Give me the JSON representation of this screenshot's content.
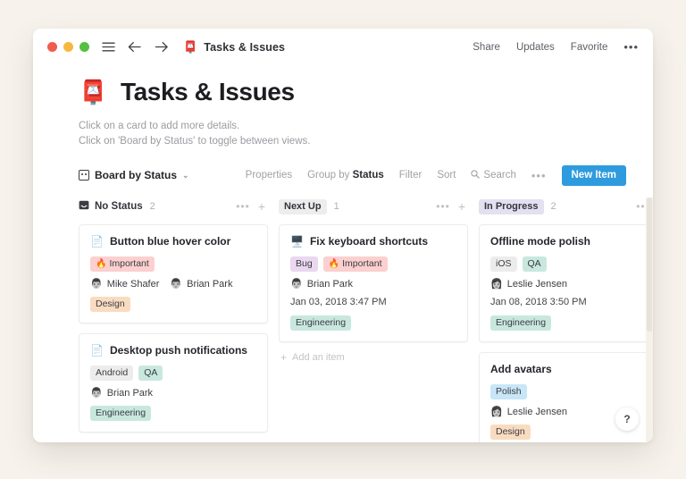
{
  "window": {
    "titlebar": {
      "doc_emoji": "📮",
      "doc_title": "Tasks & Issues",
      "actions": [
        "Share",
        "Updates",
        "Favorite"
      ],
      "more_label": "•••"
    }
  },
  "page": {
    "emoji": "📮",
    "title": "Tasks & Issues",
    "subtitle_line1": "Click on a card to add more details.",
    "subtitle_line2": "Click on 'Board by Status' to toggle between views."
  },
  "viewbar": {
    "view_name": "Board by Status",
    "caret": "⌄",
    "properties": "Properties",
    "group_by_prefix": "Group by ",
    "group_by_value": "Status",
    "filter": "Filter",
    "sort": "Sort",
    "search": "Search",
    "more": "•••",
    "new_item": "New Item"
  },
  "board": {
    "add_item_label": "Add an item",
    "col_more": "•••",
    "col_plus": "+",
    "columns": [
      {
        "name": "No Status",
        "chip_bg": "transparent",
        "has_icon": true,
        "count": "2",
        "show_add": true,
        "cards": [
          {
            "emoji": "📄",
            "title": "Button blue hover color",
            "tags": [
              {
                "label": "Important",
                "emoji": "🔥",
                "bg": "#fbd0cf",
                "color": "#3a3c41"
              }
            ],
            "people": [
              {
                "avatar": "👨",
                "name": "Mike Shafer"
              },
              {
                "avatar": "👨",
                "name": "Brian Park"
              }
            ],
            "date": "",
            "footer_tags": [
              {
                "label": "Design",
                "bg": "#f9dcc0",
                "color": "#3a3c41"
              }
            ]
          },
          {
            "emoji": "📄",
            "title": "Desktop push notifications",
            "tags": [
              {
                "label": "Android",
                "emoji": "",
                "bg": "#ececec",
                "color": "#3a3c41"
              },
              {
                "label": "QA",
                "emoji": "",
                "bg": "#c8e8de",
                "color": "#3a3c41"
              }
            ],
            "people": [
              {
                "avatar": "👨",
                "name": "Brian Park"
              }
            ],
            "date": "",
            "footer_tags": [
              {
                "label": "Engineering",
                "bg": "#c8e8de",
                "color": "#3a3c41"
              }
            ]
          }
        ]
      },
      {
        "name": "Next Up",
        "chip_bg": "#ededed",
        "has_icon": false,
        "count": "1",
        "show_add": true,
        "cards": [
          {
            "emoji": "🖥️",
            "title": "Fix keyboard shortcuts",
            "tags": [
              {
                "label": "Bug",
                "emoji": "",
                "bg": "#ead7f0",
                "color": "#3a3c41"
              },
              {
                "label": "Important",
                "emoji": "🔥",
                "bg": "#fbd0cf",
                "color": "#3a3c41"
              }
            ],
            "people": [
              {
                "avatar": "👨",
                "name": "Brian Park"
              }
            ],
            "date": "Jan 03, 2018 3:47 PM",
            "footer_tags": [
              {
                "label": "Engineering",
                "bg": "#c8e8de",
                "color": "#3a3c41"
              }
            ]
          }
        ]
      },
      {
        "name": "In Progress",
        "chip_bg": "#e3e0f2",
        "has_icon": false,
        "count": "2",
        "show_add": true,
        "cards": [
          {
            "emoji": "",
            "title": "Offline mode polish",
            "tags": [
              {
                "label": "iOS",
                "emoji": "",
                "bg": "#ececec",
                "color": "#3a3c41"
              },
              {
                "label": "QA",
                "emoji": "",
                "bg": "#c8e8de",
                "color": "#3a3c41"
              }
            ],
            "people": [
              {
                "avatar": "👩",
                "name": "Leslie Jensen"
              }
            ],
            "date": "Jan 08, 2018 3:50 PM",
            "footer_tags": [
              {
                "label": "Engineering",
                "bg": "#c8e8de",
                "color": "#3a3c41"
              }
            ]
          },
          {
            "emoji": "",
            "title": "Add avatars",
            "tags": [
              {
                "label": "Polish",
                "emoji": "",
                "bg": "#c8e6f7",
                "color": "#3a3c41"
              }
            ],
            "people": [
              {
                "avatar": "👩",
                "name": "Leslie Jensen"
              }
            ],
            "date": "",
            "footer_tags": [
              {
                "label": "Design",
                "bg": "#f9dcc0",
                "color": "#3a3c41"
              }
            ]
          }
        ]
      },
      {
        "name": "",
        "chip_bg": "#eedcf0",
        "has_icon": false,
        "count": "",
        "show_add": false,
        "cards": [
          {
            "emoji": "",
            "title": "",
            "tags": [],
            "people": [],
            "date": "",
            "footer_tags": []
          }
        ]
      }
    ]
  },
  "help": {
    "label": "?"
  },
  "colors": {
    "accent": "#2e9bde",
    "page_bg": "#f7f3ec",
    "window_bg": "#ffffff"
  }
}
